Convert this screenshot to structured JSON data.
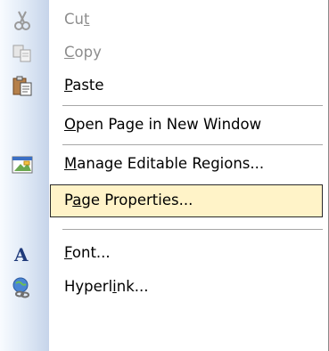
{
  "menu": {
    "items": [
      {
        "pre": "Cu",
        "ul": "t",
        "post": "",
        "enabled": false,
        "icon": "scissors-icon"
      },
      {
        "pre": "",
        "ul": "C",
        "post": "opy",
        "enabled": false,
        "icon": "copy-icon"
      },
      {
        "pre": "",
        "ul": "P",
        "post": "aste",
        "enabled": true,
        "icon": "clipboard-paste-icon"
      },
      {
        "pre": "",
        "ul": "O",
        "post": "pen Page in New Window",
        "enabled": true,
        "icon": ""
      },
      {
        "pre": "",
        "ul": "M",
        "post": "anage Editable Regions...",
        "enabled": true,
        "icon": "editable-regions-icon"
      },
      {
        "pre": "P",
        "ul": "a",
        "post": "ge Properties...",
        "enabled": true,
        "icon": "",
        "highlighted": true
      },
      {
        "pre": "",
        "ul": "F",
        "post": "ont...",
        "enabled": true,
        "icon": "font-icon"
      },
      {
        "pre": "Hyperl",
        "ul": "i",
        "post": "nk...",
        "enabled": true,
        "icon": "hyperlink-icon"
      }
    ]
  },
  "colors": {
    "highlight_bg": "#fff3c8",
    "highlight_border": "#2a2a2a",
    "disabled_text": "#8d8d8d",
    "gutter": "#c6d4ea"
  }
}
